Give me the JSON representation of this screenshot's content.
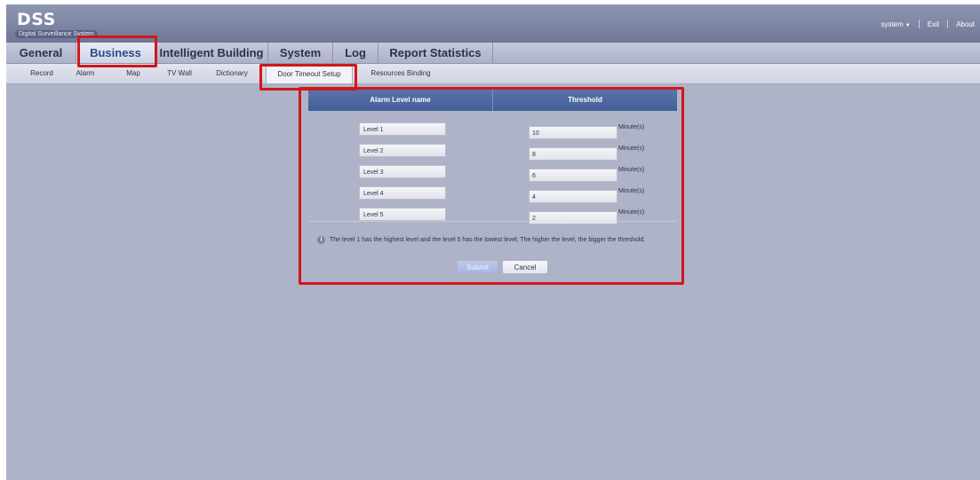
{
  "app": {
    "logo": "DSS",
    "subtitle": "Digital Surveillance System"
  },
  "top_links": {
    "user": "system",
    "exit": "Exit",
    "about": "About"
  },
  "main_tabs": [
    {
      "label": "General",
      "active": false
    },
    {
      "label": "Business",
      "active": true
    },
    {
      "label": "Intelligent Building",
      "active": false
    },
    {
      "label": "System",
      "active": false
    },
    {
      "label": "Log",
      "active": false
    },
    {
      "label": "Report Statistics",
      "active": false
    }
  ],
  "sub_tabs": [
    {
      "label": "Record",
      "active": false
    },
    {
      "label": "Alarm",
      "active": false
    },
    {
      "label": "Map",
      "active": false
    },
    {
      "label": "TV Wall",
      "active": false
    },
    {
      "label": "Dictionary",
      "active": false
    },
    {
      "label": "Door Timeout Setup",
      "active": true
    },
    {
      "label": "Resources Binding",
      "active": false
    }
  ],
  "table": {
    "col_name": "Alarm Level name",
    "col_threshold": "Threshold",
    "rows": [
      {
        "name": "Level 1",
        "threshold": "10",
        "unit": "Minute(s)"
      },
      {
        "name": "Level 2",
        "threshold": "8",
        "unit": "Minute(s)"
      },
      {
        "name": "Level 3",
        "threshold": "6",
        "unit": "Minute(s)"
      },
      {
        "name": "Level 4",
        "threshold": "4",
        "unit": "Minute(s)"
      },
      {
        "name": "Level 5",
        "threshold": "2",
        "unit": "Minute(s)"
      }
    ]
  },
  "note": "The level 1 has the highest level and the level 5 has the lowest level; The higher the level, the bigger the threshold.",
  "buttons": {
    "submit": "Submit",
    "cancel": "Cancel"
  },
  "colors": {
    "highlight": "#d3161b",
    "header": "#5a73aa",
    "background": "#aeb3c8"
  }
}
